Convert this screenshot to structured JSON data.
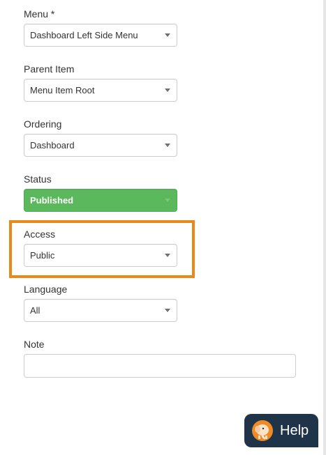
{
  "form": {
    "menu": {
      "label": "Menu *",
      "value": "Dashboard Left Side Menu"
    },
    "parent_item": {
      "label": "Parent Item",
      "value": "Menu Item Root"
    },
    "ordering": {
      "label": "Ordering",
      "value": "Dashboard"
    },
    "status": {
      "label": "Status",
      "value": "Published"
    },
    "access": {
      "label": "Access",
      "value": "Public"
    },
    "language": {
      "label": "Language",
      "value": "All"
    },
    "note": {
      "label": "Note",
      "value": ""
    }
  },
  "help": {
    "label": "Help",
    "icon": "elephant-mascot-icon"
  },
  "colors": {
    "status_published": "#5cb85c",
    "highlight": "#e8891a",
    "help_bg": "#1f3349",
    "help_avatar": "#f08a24"
  }
}
